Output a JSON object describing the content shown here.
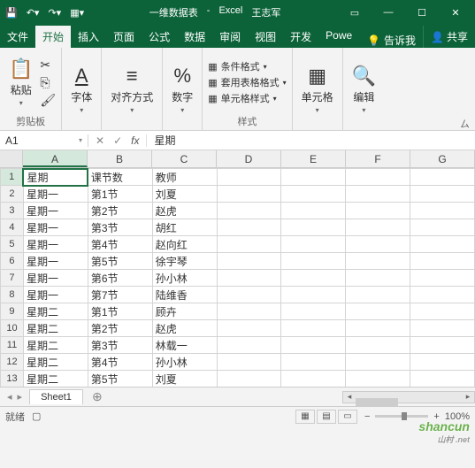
{
  "titlebar": {
    "doc_name": "一维数据表",
    "app_name": "Excel",
    "user": "王志军"
  },
  "tabs": {
    "items": [
      "文件",
      "开始",
      "插入",
      "页面",
      "公式",
      "数据",
      "审阅",
      "视图",
      "开发",
      "Powe"
    ],
    "active_index": 1,
    "tellme": "告诉我",
    "share": "共享"
  },
  "ribbon": {
    "paste": "粘贴",
    "clipboard": "剪贴板",
    "font": "字体",
    "alignment": "对齐方式",
    "number": "数字",
    "cond_format": "条件格式",
    "table_format": "套用表格格式",
    "cell_styles": "单元格样式",
    "styles": "样式",
    "cells": "单元格",
    "editing": "编辑"
  },
  "name_box": "A1",
  "formula_value": "星期",
  "columns": [
    "A",
    "B",
    "C",
    "D",
    "E",
    "F",
    "G"
  ],
  "active_col": 0,
  "active_row": 1,
  "rows": [
    {
      "n": 1,
      "cells": [
        "星期",
        "课节数",
        "教师",
        "",
        "",
        "",
        ""
      ]
    },
    {
      "n": 2,
      "cells": [
        "星期一",
        "第1节",
        "刘夏",
        "",
        "",
        "",
        ""
      ]
    },
    {
      "n": 3,
      "cells": [
        "星期一",
        "第2节",
        "赵虎",
        "",
        "",
        "",
        ""
      ]
    },
    {
      "n": 4,
      "cells": [
        "星期一",
        "第3节",
        "胡红",
        "",
        "",
        "",
        ""
      ]
    },
    {
      "n": 5,
      "cells": [
        "星期一",
        "第4节",
        "赵向红",
        "",
        "",
        "",
        ""
      ]
    },
    {
      "n": 6,
      "cells": [
        "星期一",
        "第5节",
        "徐宇琴",
        "",
        "",
        "",
        ""
      ]
    },
    {
      "n": 7,
      "cells": [
        "星期一",
        "第6节",
        "孙小林",
        "",
        "",
        "",
        ""
      ]
    },
    {
      "n": 8,
      "cells": [
        "星期一",
        "第7节",
        "陆维香",
        "",
        "",
        "",
        ""
      ]
    },
    {
      "n": 9,
      "cells": [
        "星期二",
        "第1节",
        "顾卉",
        "",
        "",
        "",
        ""
      ]
    },
    {
      "n": 10,
      "cells": [
        "星期二",
        "第2节",
        "赵虎",
        "",
        "",
        "",
        ""
      ]
    },
    {
      "n": 11,
      "cells": [
        "星期二",
        "第3节",
        "林载一",
        "",
        "",
        "",
        ""
      ]
    },
    {
      "n": 12,
      "cells": [
        "星期二",
        "第4节",
        "孙小林",
        "",
        "",
        "",
        ""
      ]
    },
    {
      "n": 13,
      "cells": [
        "星期二",
        "第5节",
        "刘夏",
        "",
        "",
        "",
        ""
      ]
    }
  ],
  "sheet": {
    "name": "Sheet1"
  },
  "status": {
    "ready": "就绪",
    "zoom": "100%"
  },
  "watermark": {
    "main": "shancun",
    "sub": "山村 .net"
  }
}
